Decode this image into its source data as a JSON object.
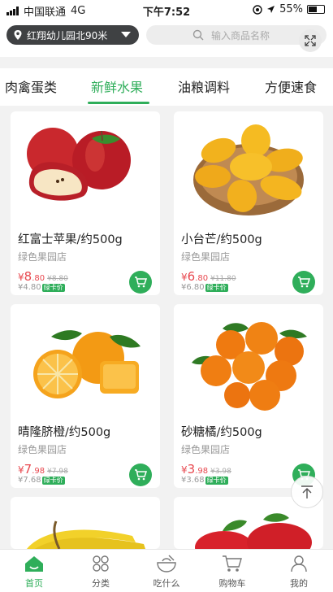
{
  "status_bar": {
    "carrier": "中国联通",
    "network": "4G",
    "time": "下午7:52",
    "battery": "55%"
  },
  "header": {
    "location": "红翔幼儿园北90米",
    "search_placeholder": "输入商品名称"
  },
  "tabs": [
    "肉禽蛋类",
    "新鲜水果",
    "油粮调料",
    "方便速食"
  ],
  "active_tab": "新鲜水果",
  "products": [
    {
      "name": "红富士苹果/约500g",
      "store": "绿色果园店",
      "currency": "¥",
      "price_main": "8",
      "price_dec": ".80",
      "old_price": "¥8.80",
      "card_price": "¥4.80",
      "card_tag": "绿卡价"
    },
    {
      "name": "小台芒/约500g",
      "store": "绿色果园店",
      "currency": "¥",
      "price_main": "6",
      "price_dec": ".80",
      "old_price": "¥11.80",
      "card_price": "¥6.80",
      "card_tag": "绿卡价"
    },
    {
      "name": "晴隆脐橙/约500g",
      "store": "绿色果园店",
      "currency": "¥",
      "price_main": "7",
      "price_dec": ".98",
      "old_price": "¥7.98",
      "card_price": "¥7.68",
      "card_tag": "绿卡价"
    },
    {
      "name": "砂糖橘/约500g",
      "store": "绿色果园店",
      "currency": "¥",
      "price_main": "3",
      "price_dec": ".98",
      "old_price": "¥3.98",
      "card_price": "¥3.68",
      "card_tag": "绿卡价"
    }
  ],
  "bottom_nav": [
    {
      "label": "首页",
      "icon": "home-icon"
    },
    {
      "label": "分类",
      "icon": "grid-icon"
    },
    {
      "label": "吃什么",
      "icon": "bowl-icon"
    },
    {
      "label": "购物车",
      "icon": "cart-icon"
    },
    {
      "label": "我的",
      "icon": "user-icon"
    }
  ],
  "colors": {
    "accent": "#2fae5a",
    "price": "#e8484f",
    "pill": "#3f4143"
  }
}
